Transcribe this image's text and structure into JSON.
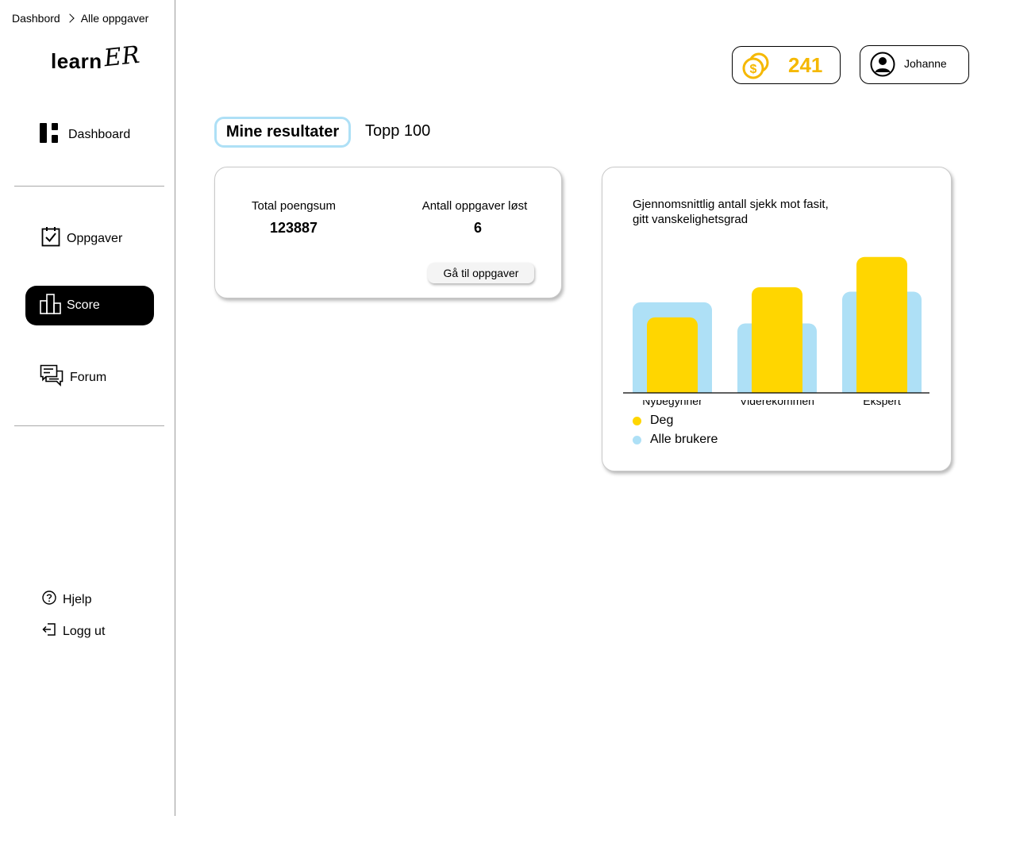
{
  "breadcrumb": {
    "items": [
      "Dashbord",
      "Alle oppgaver"
    ]
  },
  "logo": {
    "text_main": "learn",
    "text_accent": "ER"
  },
  "sidebar": {
    "items": [
      {
        "label": "Dashboard",
        "icon": "dashboard-icon"
      },
      {
        "label": "Oppgaver",
        "icon": "task-checklist-icon"
      },
      {
        "label": "Score",
        "icon": "bar-chart-icon",
        "active": true
      },
      {
        "label": "Forum",
        "icon": "forum-chat-icon"
      }
    ],
    "footer": [
      {
        "label": "Hjelp",
        "icon": "help-icon"
      },
      {
        "label": "Logg ut",
        "icon": "logout-icon"
      }
    ]
  },
  "header": {
    "coins": "241",
    "user_name": "Johanne"
  },
  "tabs": [
    {
      "label": "Mine resultater",
      "active": true
    },
    {
      "label": "Topp 100",
      "active": false
    }
  ],
  "stats_card": {
    "total_label": "Total poengsum",
    "total_value": "123887",
    "solved_label": "Antall oppgaver løst",
    "solved_value": "6",
    "button_label": "Gå til oppgaver"
  },
  "chart_data": {
    "type": "bar",
    "title_line1": "Gjennomsnittlig antall sjekk mot fasit,",
    "title_line2": "gitt vanskelighetsgrad",
    "categories": [
      "Nybegynner",
      "Viderekommen",
      "Ekspert"
    ],
    "series": [
      {
        "name": "Deg",
        "color": "#ffd600",
        "values": [
          5,
          7,
          9
        ]
      },
      {
        "name": "Alle brukere",
        "color": "#aee0f6",
        "values": [
          6,
          4.6,
          6.7
        ]
      }
    ],
    "ylim": [
      0,
      9.2
    ],
    "legend_position": "bottom-left"
  },
  "colors": {
    "accent_yellow": "#ffd600",
    "accent_blue": "#aee0f6",
    "coin": "#f5b800"
  }
}
